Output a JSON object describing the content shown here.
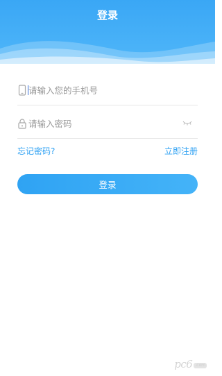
{
  "header": {
    "title": "登录"
  },
  "form": {
    "phone_placeholder": "请输入您的手机号",
    "password_placeholder": "请输入密码",
    "forgot_password": "忘记密码?",
    "register": "立即注册",
    "login_button": "登录"
  },
  "icons": {
    "phone": "phone-icon",
    "lock": "lock-icon",
    "eye": "eye-closed-icon"
  },
  "colors": {
    "accent": "#2ea1f3",
    "header": "#3aa7f5"
  },
  "watermark": {
    "text": "pc6",
    "domain": ".com"
  }
}
